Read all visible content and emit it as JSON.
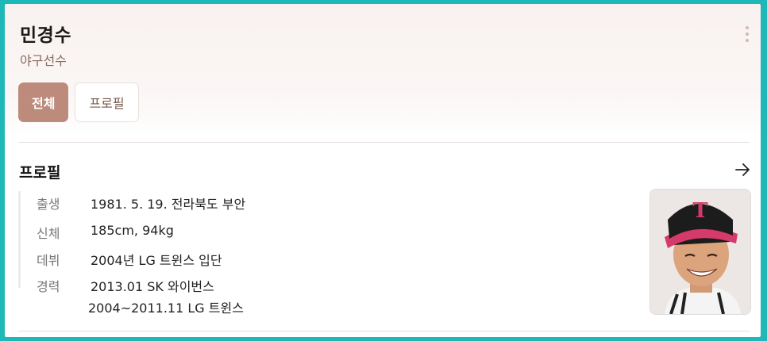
{
  "header": {
    "title": "민경수",
    "subtitle": "야구선수"
  },
  "tabs": [
    {
      "label": "전체",
      "active": true
    },
    {
      "label": "프로필",
      "active": false
    }
  ],
  "profile": {
    "section_title": "프로필",
    "rows": [
      {
        "key": "출생",
        "value": "1981. 5. 19. 전라북도 부안"
      },
      {
        "key": "신체",
        "value": "185cm, 94kg"
      },
      {
        "key": "데뷔",
        "value": "2004년 LG 트윈스 입단"
      },
      {
        "key": "경력",
        "value": "2013.01 SK 와이번스"
      }
    ],
    "career_continued": "2004~2011.11 LG 트윈스",
    "photo_icon": "person-photo"
  },
  "colors": {
    "accent": "#bd8b7c",
    "border": "#1fb8b8"
  }
}
